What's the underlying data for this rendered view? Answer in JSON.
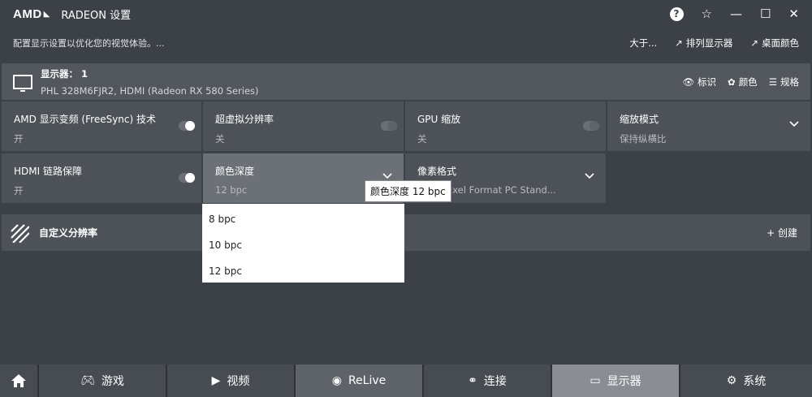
{
  "titlebar": {
    "logo": "AMD",
    "title": "RADEON 设置",
    "help": "?",
    "star": "☆",
    "minimize": "—",
    "maximize": "☐",
    "close": "✕"
  },
  "subheader": {
    "hint": "配置显示设置以优化您的视觉体验。...",
    "about": "大于...",
    "arrange": "排列显示器",
    "desktop_color": "桌面颜色"
  },
  "display": {
    "title": "显示器： 1",
    "subtitle": "PHL 328M6FJR2, HDMI (Radeon RX 580 Series)",
    "actions": {
      "label": "标识",
      "color": "颜色",
      "spec": "规格"
    }
  },
  "tiles": {
    "freesync": {
      "label": "AMD 显示变频 (FreeSync) 技术",
      "value": "开"
    },
    "vsr": {
      "label": "超虚拟分辨率",
      "value": "关"
    },
    "gpu_scaling": {
      "label": "GPU 缩放",
      "value": "关"
    },
    "scaling_mode": {
      "label": "缩放模式",
      "value": "保持纵横比"
    },
    "hdmi_link": {
      "label": "HDMI 链路保障",
      "value": "开"
    },
    "color_depth": {
      "label": "颜色深度",
      "value": "12 bpc"
    },
    "pixel_format": {
      "label": "像素格式",
      "value": "4:4:4 Pixel Format PC Stand..."
    }
  },
  "tooltip": "颜色深度 12 bpc",
  "custom": {
    "label": "自定义分辨率",
    "create": "+ 创建"
  },
  "dropdown": [
    "8 bpc",
    "10 bpc",
    "12 bpc"
  ],
  "tabs": {
    "games": "游戏",
    "video": "视频",
    "relive": "ReLive",
    "connect": "连接",
    "display": "显示器",
    "system": "系统"
  }
}
